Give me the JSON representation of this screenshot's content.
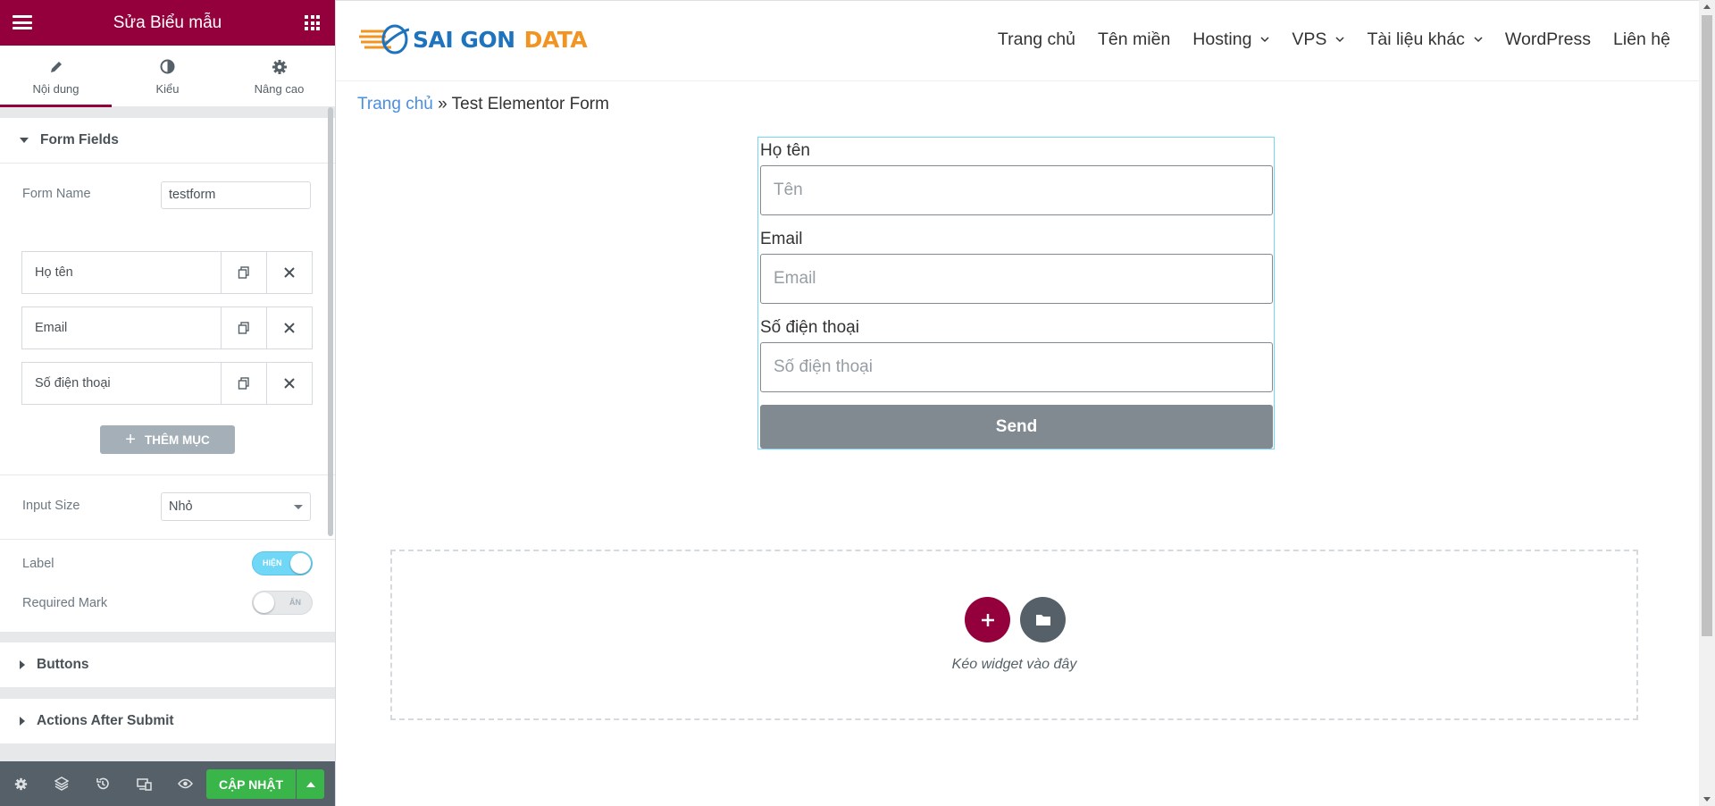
{
  "panel": {
    "title": "Sửa Biểu mẫu",
    "tabs": [
      {
        "label": "Nội dung",
        "icon": "pencil-icon"
      },
      {
        "label": "Kiểu",
        "icon": "half-circle-icon"
      },
      {
        "label": "Nâng cao",
        "icon": "gear-icon"
      }
    ],
    "form_fields": {
      "title": "Form Fields",
      "form_name_label": "Form Name",
      "form_name_value": "testform",
      "items": [
        {
          "label": "Họ tên"
        },
        {
          "label": "Email"
        },
        {
          "label": "Số điện thoại"
        }
      ],
      "add_item_label": "THÊM MỤC",
      "input_size_label": "Input Size",
      "input_size_value": "Nhỏ",
      "label_label": "Label",
      "label_switch": "HIỆN",
      "required_mark_label": "Required Mark",
      "required_mark_switch": "ẨN"
    },
    "sections": [
      {
        "title": "Buttons"
      },
      {
        "title": "Actions After Submit"
      }
    ],
    "footer": {
      "update_label": "CẬP NHẬT"
    }
  },
  "site": {
    "logo": {
      "word1": "SAI GON",
      "word2": "DATA"
    },
    "nav": [
      "Trang chủ",
      "Tên miền",
      "Hosting",
      "VPS",
      "Tài liệu khác",
      "WordPress",
      "Liên hệ"
    ],
    "breadcrumb": {
      "home": "Trang chủ",
      "separator": " » ",
      "current": "Test Elementor Form"
    },
    "form": {
      "fields": [
        {
          "label": "Họ tên",
          "placeholder": "Tên"
        },
        {
          "label": "Email",
          "placeholder": "Email"
        },
        {
          "label": "Số điện thoại",
          "placeholder": "Số điện thoại"
        }
      ],
      "submit": "Send"
    },
    "dropzone_text": "Kéo widget vào đây"
  },
  "colors": {
    "brand": "#93003c",
    "update_green": "#39b54a",
    "selection_outline": "#71d7f7",
    "link_blue": "#4a8fe0"
  }
}
